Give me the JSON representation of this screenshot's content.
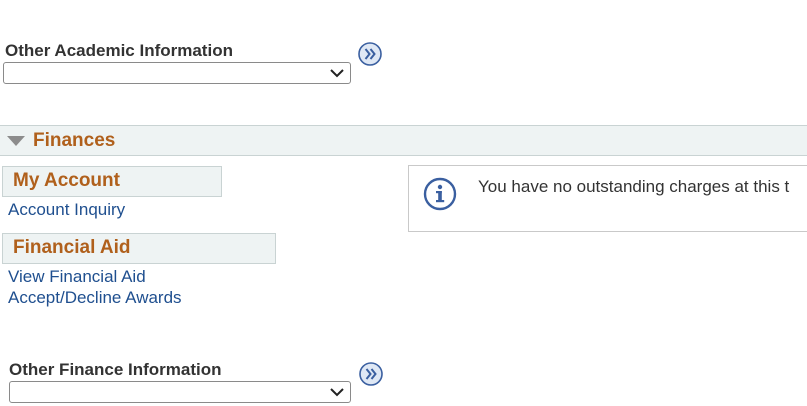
{
  "academic": {
    "other_label": "Other Academic Information",
    "other_select_value": ""
  },
  "finances": {
    "section_title": "Finances",
    "my_account": {
      "title": "My Account",
      "links": [
        "Account Inquiry"
      ]
    },
    "financial_aid": {
      "title": "Financial Aid",
      "links": [
        "View Financial Aid",
        "Accept/Decline Awards"
      ]
    },
    "notice_text": "You have no outstanding charges at this t",
    "other_label": "Other Finance Information",
    "other_select_value": ""
  },
  "icons": {
    "go": "double-chevron-right-icon",
    "collapse": "triangle-down-icon",
    "info": "info-icon",
    "dropdown": "chevron-down-icon"
  },
  "colors": {
    "section_title": "#b0601c",
    "link": "#1f4f8f",
    "bar_bg": "#eef3f3",
    "icon_blue": "#3a5fa0"
  }
}
